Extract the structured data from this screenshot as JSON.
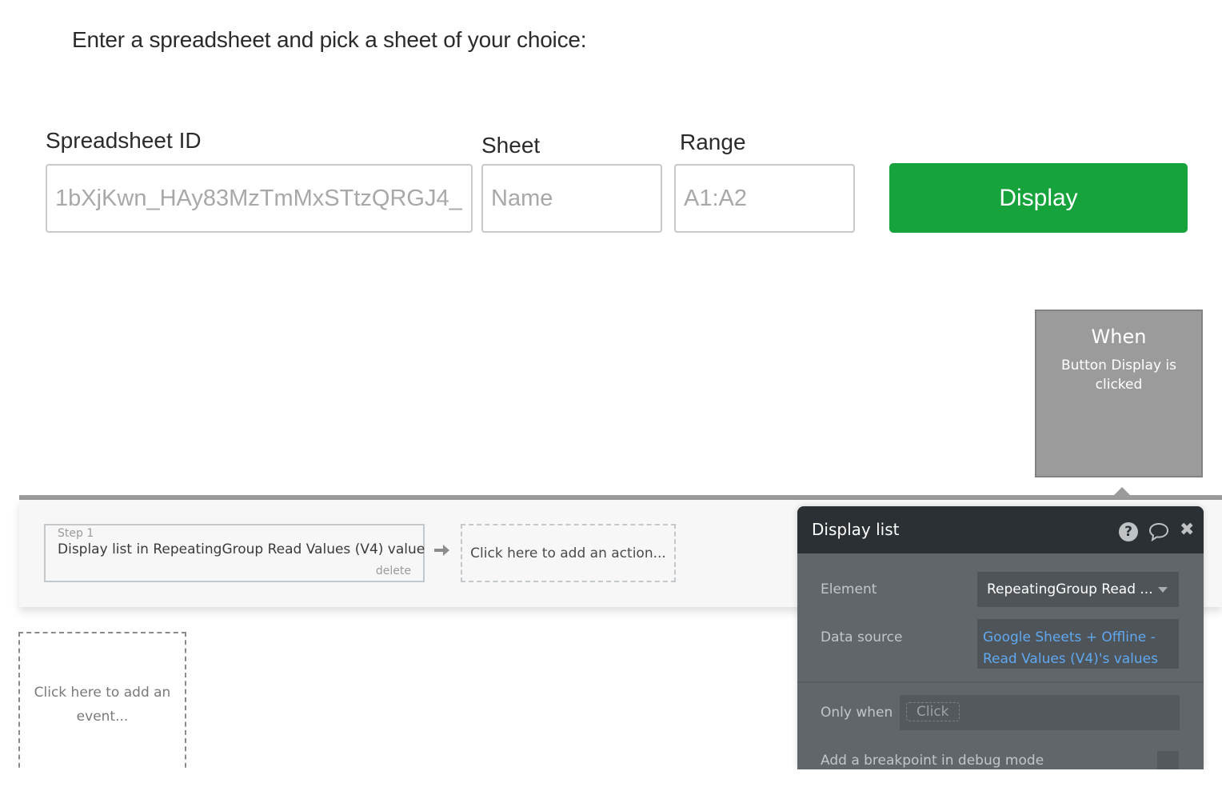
{
  "page": {
    "heading": "Enter a spreadsheet and pick a sheet of your choice:"
  },
  "form": {
    "spreadsheet_id": {
      "label": "Spreadsheet ID",
      "placeholder": "1bXjKwn_HAy83MzTmMxSTtzQRGJ4_"
    },
    "sheet": {
      "label": "Sheet",
      "placeholder": "Name"
    },
    "range": {
      "label": "Range",
      "placeholder": "A1:A2"
    },
    "display_button": {
      "label": "Display",
      "color": "#16a33c"
    }
  },
  "event_card": {
    "title": "When",
    "subtitle": "Button Display is clicked"
  },
  "workflow": {
    "steps": [
      {
        "number": "Step 1",
        "text": "Display list in RepeatingGroup Read Values (V4) value",
        "delete_label": "delete"
      }
    ],
    "add_action_label": "Click here to add an action...",
    "add_event_label": "Click here to add an event..."
  },
  "property_panel": {
    "title": "Display list",
    "icons": [
      "help-icon",
      "comment-icon",
      "close-icon"
    ],
    "element": {
      "label": "Element",
      "value": "RepeatingGroup Read ..."
    },
    "data_source": {
      "label": "Data source",
      "value": "Google Sheets + Offline - Read Values (V4)'s values",
      "color": "#5fa8f0"
    },
    "only_when": {
      "label": "Only when",
      "chip": "Click"
    },
    "breakpoint": {
      "label": "Add a breakpoint in debug mode"
    }
  }
}
